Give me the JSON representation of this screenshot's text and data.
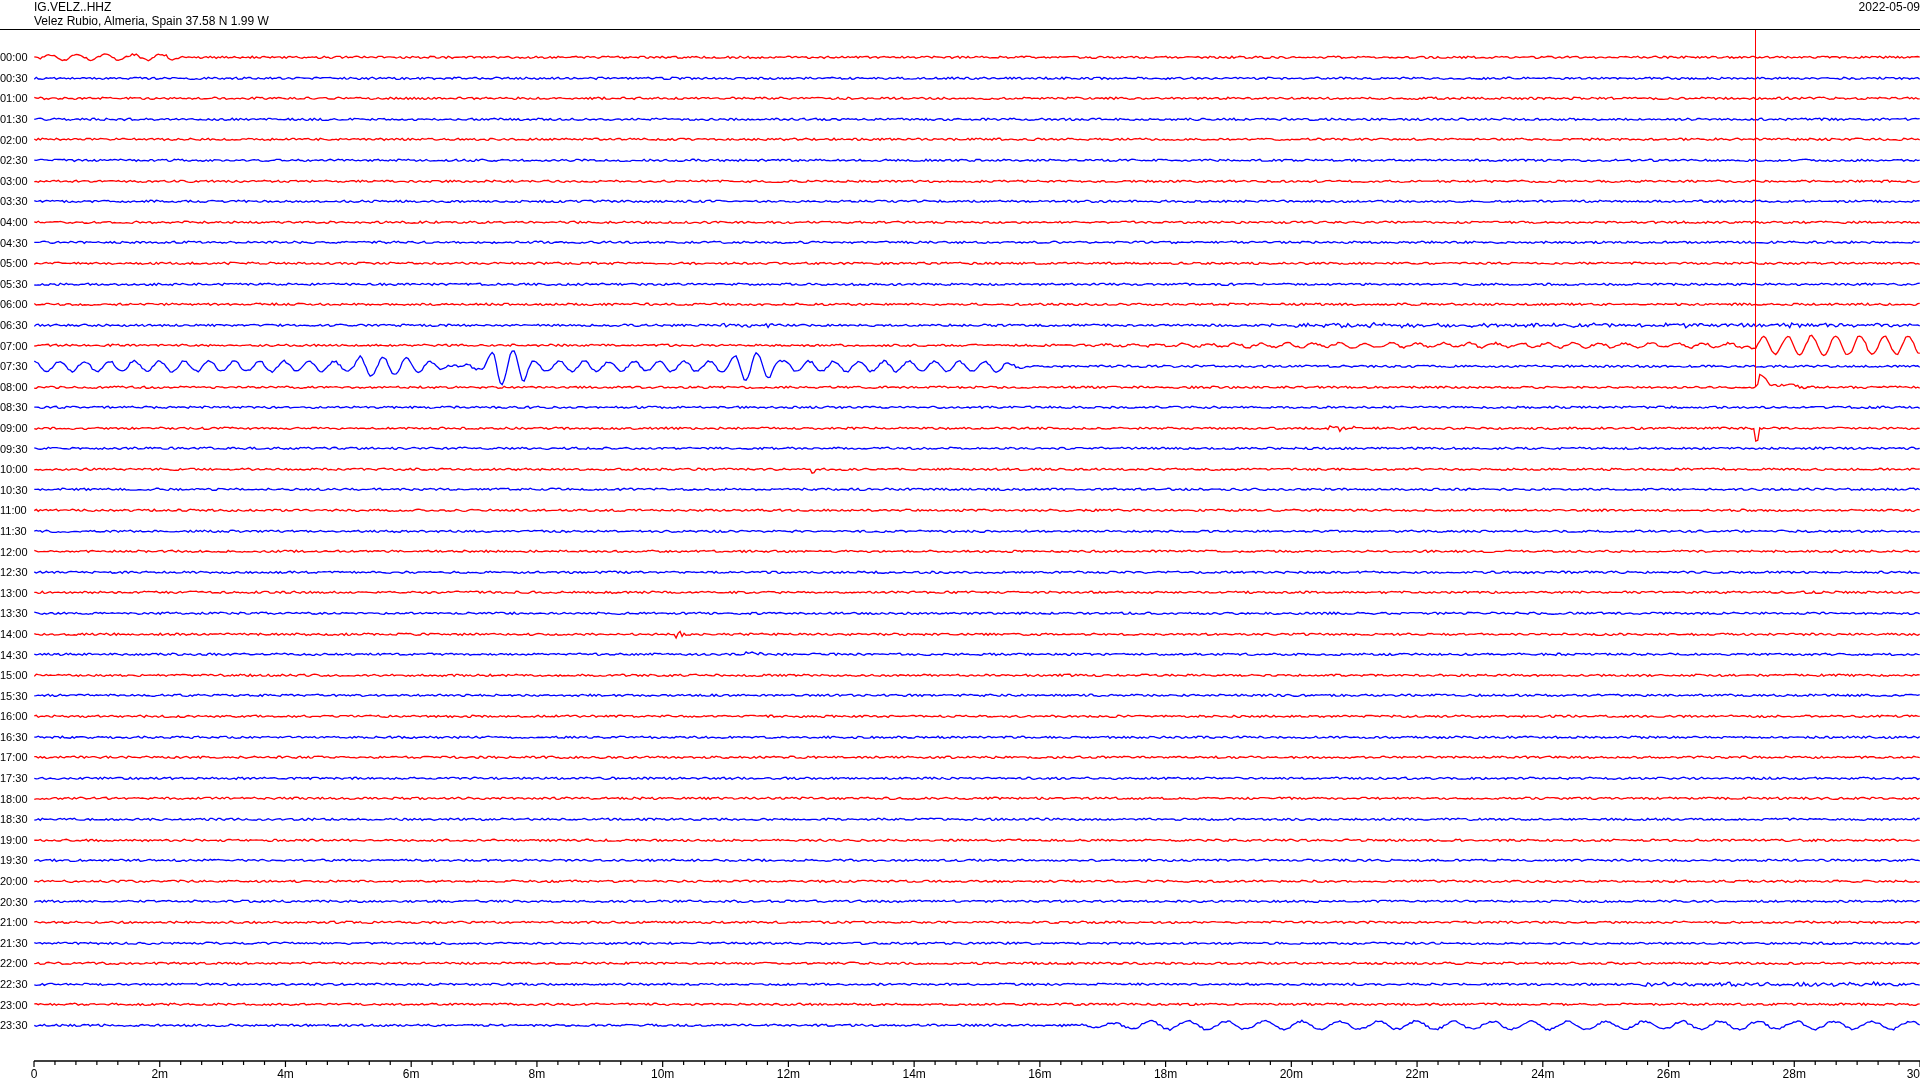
{
  "header": {
    "station": "IG.VELZ..HHZ",
    "location": "Velez Rubio, Almeria, Spain  37.58 N 1.99 W",
    "date": "2022-05-09"
  },
  "traces": [
    {
      "time": "00:00",
      "color": "#ff0000"
    },
    {
      "time": "00:30",
      "color": "#0000ff"
    },
    {
      "time": "01:00",
      "color": "#ff0000"
    },
    {
      "time": "01:30",
      "color": "#0000ff"
    },
    {
      "time": "02:00",
      "color": "#ff0000"
    },
    {
      "time": "02:30",
      "color": "#0000ff"
    },
    {
      "time": "03:00",
      "color": "#ff0000"
    },
    {
      "time": "03:30",
      "color": "#0000ff"
    },
    {
      "time": "04:00",
      "color": "#ff0000"
    },
    {
      "time": "04:30",
      "color": "#0000ff"
    },
    {
      "time": "05:00",
      "color": "#ff0000"
    },
    {
      "time": "05:30",
      "color": "#0000ff"
    },
    {
      "time": "06:00",
      "color": "#ff0000"
    },
    {
      "time": "06:30",
      "color": "#0000ff"
    },
    {
      "time": "07:00",
      "color": "#ff0000"
    },
    {
      "time": "07:30",
      "color": "#0000ff"
    },
    {
      "time": "08:00",
      "color": "#ff0000"
    },
    {
      "time": "08:30",
      "color": "#0000ff"
    },
    {
      "time": "09:00",
      "color": "#ff0000"
    },
    {
      "time": "09:30",
      "color": "#0000ff"
    },
    {
      "time": "10:00",
      "color": "#ff0000"
    },
    {
      "time": "10:30",
      "color": "#0000ff"
    },
    {
      "time": "11:00",
      "color": "#ff0000"
    },
    {
      "time": "11:30",
      "color": "#0000ff"
    },
    {
      "time": "12:00",
      "color": "#ff0000"
    },
    {
      "time": "12:30",
      "color": "#0000ff"
    },
    {
      "time": "13:00",
      "color": "#ff0000"
    },
    {
      "time": "13:30",
      "color": "#0000ff"
    },
    {
      "time": "14:00",
      "color": "#ff0000"
    },
    {
      "time": "14:30",
      "color": "#0000ff"
    },
    {
      "time": "15:00",
      "color": "#ff0000"
    },
    {
      "time": "15:30",
      "color": "#0000ff"
    },
    {
      "time": "16:00",
      "color": "#ff0000"
    },
    {
      "time": "16:30",
      "color": "#0000ff"
    },
    {
      "time": "17:00",
      "color": "#ff0000"
    },
    {
      "time": "17:30",
      "color": "#0000ff"
    },
    {
      "time": "18:00",
      "color": "#ff0000"
    },
    {
      "time": "18:30",
      "color": "#0000ff"
    },
    {
      "time": "19:00",
      "color": "#ff0000"
    },
    {
      "time": "19:30",
      "color": "#0000ff"
    },
    {
      "time": "20:00",
      "color": "#ff0000"
    },
    {
      "time": "20:30",
      "color": "#0000ff"
    },
    {
      "time": "21:00",
      "color": "#ff0000"
    },
    {
      "time": "21:30",
      "color": "#0000ff"
    },
    {
      "time": "22:00",
      "color": "#ff0000"
    },
    {
      "time": "22:30",
      "color": "#0000ff"
    },
    {
      "time": "23:00",
      "color": "#ff0000"
    },
    {
      "time": "23:30",
      "color": "#0000ff"
    }
  ],
  "x_axis": {
    "ticks": [
      "0",
      "2m",
      "4m",
      "6m",
      "8m",
      "10m",
      "12m",
      "14m",
      "16m",
      "18m",
      "20m",
      "22m",
      "24m",
      "26m",
      "28m",
      "30"
    ]
  }
}
